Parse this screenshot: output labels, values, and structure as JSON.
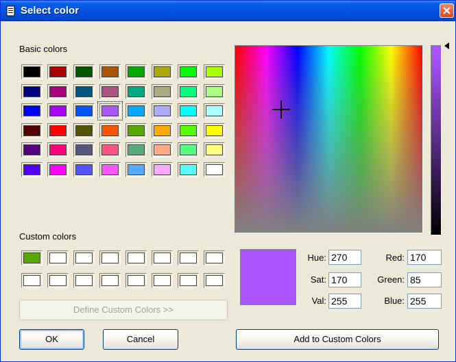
{
  "window": {
    "title": "Select color",
    "accent": "#0054e3",
    "close_color": "#d5462a"
  },
  "basic_colors": {
    "label": "Basic colors",
    "rows": [
      [
        "#000000",
        "#aa0000",
        "#005500",
        "#aa5500",
        "#00aa00",
        "#aaaa00",
        "#00ff00",
        "#aaff00"
      ],
      [
        "#000080",
        "#aa0080",
        "#005580",
        "#aa5580",
        "#00aa80",
        "#aaaa80",
        "#00ff80",
        "#aaff80"
      ],
      [
        "#0000ff",
        "#aa00ff",
        "#0055ff",
        "#aa55ff",
        "#00aaff",
        "#aaaaff",
        "#00ffff",
        "#aaffff"
      ],
      [
        "#550000",
        "#ff0000",
        "#555500",
        "#ff5500",
        "#55aa00",
        "#ffaa00",
        "#55ff00",
        "#ffff00"
      ],
      [
        "#550080",
        "#ff0080",
        "#555580",
        "#ff5580",
        "#55aa80",
        "#ffaa80",
        "#55ff80",
        "#ffff80"
      ],
      [
        "#5500ff",
        "#ff00ff",
        "#5555ff",
        "#ff55ff",
        "#55aaff",
        "#ffaaff",
        "#55ffff",
        "#ffffff"
      ]
    ],
    "selected": [
      2,
      3
    ]
  },
  "custom_colors": {
    "label": "Custom colors",
    "rows": [
      [
        "#55aa00",
        "#ffffff",
        "#ffffff",
        "#ffffff",
        "#ffffff",
        "#ffffff",
        "#ffffff",
        "#ffffff"
      ],
      [
        "#ffffff",
        "#ffffff",
        "#ffffff",
        "#ffffff",
        "#ffffff",
        "#ffffff",
        "#ffffff",
        "#ffffff"
      ]
    ]
  },
  "define_button": "Define Custom Colors >>",
  "ok_button": "OK",
  "cancel_button": "Cancel",
  "add_button": "Add to Custom Colors",
  "current_color": "#aa55ff",
  "fields": {
    "hue_label": "Hue:",
    "hue": "270",
    "sat_label": "Sat:",
    "sat": "170",
    "val_label": "Val:",
    "val": "255",
    "red_label": "Red:",
    "red": "170",
    "green_label": "Green:",
    "green": "85",
    "blue_label": "Blue:",
    "blue": "255"
  }
}
